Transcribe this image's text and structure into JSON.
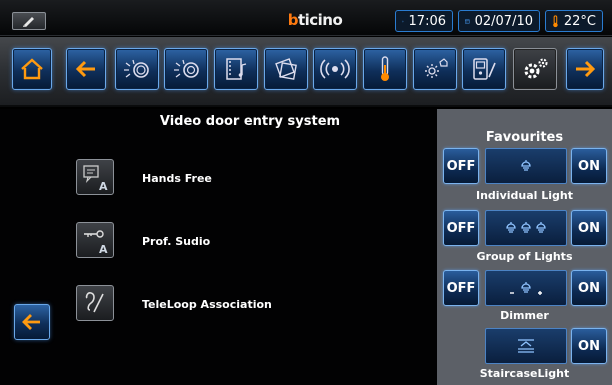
{
  "topbar": {
    "brand_b": "b",
    "brand_rest": "ticino",
    "time": "17:06",
    "date": "02/07/10",
    "temperature": "22°C"
  },
  "toolbar": {
    "icons": [
      "home-icon",
      "back-arrow-icon",
      "lighting-icon",
      "lighting-group-icon",
      "multimedia-icon",
      "scenarios-icon",
      "sound-icon",
      "temperature-icon",
      "energy-icon",
      "video-door-entry-icon",
      "settings-icon",
      "forward-arrow-icon"
    ]
  },
  "main": {
    "title": "Video door entry system",
    "functions": [
      {
        "label": "Hands Free",
        "icon": "hands-free-icon"
      },
      {
        "label": "Prof. Sudio",
        "icon": "professional-studio-icon"
      },
      {
        "label": "TeleLoop Association",
        "icon": "teleloop-icon"
      }
    ]
  },
  "favourites": {
    "title": "Favourites",
    "off_label": "OFF",
    "on_label": "ON",
    "items": [
      {
        "label": "Individual Light"
      },
      {
        "label": "Group of Lights"
      },
      {
        "label": "Dimmer"
      },
      {
        "label": "StaircaseLight"
      }
    ]
  },
  "colors": {
    "accent_blue": "#2a7cd1",
    "orange": "#ff8a00",
    "panel_grey": "#5c6067"
  }
}
